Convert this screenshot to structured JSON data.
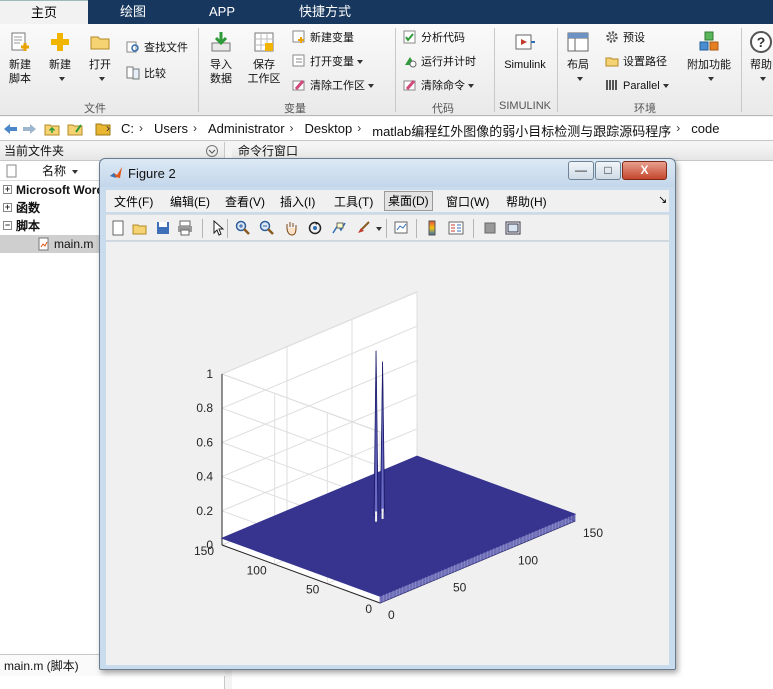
{
  "tabs": [
    {
      "label": "主页",
      "active": true
    },
    {
      "label": "绘图",
      "active": false
    },
    {
      "label": "APP",
      "active": false
    },
    {
      "label": "快捷方式",
      "active": false
    }
  ],
  "ribbon": {
    "file_group": {
      "label": "文件",
      "new_script": "新建\n脚本",
      "new": "新建",
      "open": "打开",
      "find_files": "查找文件",
      "compare": "比较"
    },
    "variable_group": {
      "label": "变量",
      "import_data": "导入\n数据",
      "save_workspace": "保存\n工作区",
      "new_variable": "新建变量",
      "open_variable": "打开变量",
      "clear_workspace": "清除工作区"
    },
    "code_group": {
      "label": "代码",
      "analyze_code": "分析代码",
      "run_and_time": "运行并计时",
      "clear_commands": "清除命令"
    },
    "simulink_group": {
      "label": "SIMULINK",
      "simulink": "Simulink"
    },
    "environment_group": {
      "label": "环境",
      "layout": "布局",
      "preferences": "预设",
      "set_path": "设置路径",
      "parallel": "Parallel",
      "addons": "附加功能"
    },
    "resources_group": {
      "help": "帮助"
    }
  },
  "path": {
    "crumbs": [
      "C:",
      "Users",
      "Administrator",
      "Desktop",
      "matlab编程红外图像的弱小目标检测与跟踪源码程序",
      "code"
    ]
  },
  "file_panel": {
    "title": "当前文件夹",
    "column_name": "名称",
    "tree": [
      {
        "label": "Microsoft Word ...",
        "expander": "+",
        "bold": true,
        "selected": false,
        "indent": 16
      },
      {
        "label": "函数",
        "expander": "+",
        "bold": true,
        "selected": false,
        "indent": 16
      },
      {
        "label": "脚本",
        "expander": "−",
        "bold": true,
        "selected": false,
        "indent": 16
      },
      {
        "label": "main.m",
        "expander": "",
        "bold": false,
        "selected": true,
        "indent": 54
      }
    ],
    "status": "main.m  (脚本)"
  },
  "command_window": {
    "title": "命令行窗口"
  },
  "figure": {
    "title": "Figure 2",
    "min_label": "—",
    "max_label": "□",
    "close_label": "X",
    "menus": [
      "文件(F)",
      "编辑(E)",
      "查看(V)",
      "插入(I)",
      "工具(T)",
      "桌面(D)",
      "窗口(W)",
      "帮助(H)"
    ],
    "active_menu_index": 5,
    "menu_dock_glyph": "↘",
    "toolbar_icons": [
      "new-figure-icon",
      "open-file-icon",
      "save-icon",
      "print-icon",
      "pointer-icon",
      "zoom-in-icon",
      "zoom-out-icon",
      "pan-icon",
      "rotate-3d-icon",
      "data-cursor-icon",
      "brush-icon",
      "link-plot-icon",
      "colorbar-icon",
      "legend-icon",
      "hide-plot-tools-icon",
      "show-plot-tools-icon"
    ]
  },
  "chart_data": {
    "type": "surface",
    "title": "",
    "xlabel": "",
    "ylabel": "",
    "zlabel": "",
    "x_ticks": [
      0,
      50,
      100,
      150
    ],
    "y_ticks": [
      0,
      50,
      100,
      150
    ],
    "z_ticks": [
      0,
      0.2,
      0.4,
      0.6,
      0.8,
      1
    ],
    "z_tick_labels": [
      "0",
      "0.2",
      "0.4",
      "0.6",
      "0.8",
      "1"
    ],
    "xlim": [
      0,
      150
    ],
    "ylim": [
      0,
      150
    ],
    "zlim": [
      0,
      1
    ],
    "grid": true,
    "surface_color": "#36348f",
    "baseline_z": 0.04,
    "peaks": [
      {
        "x": 78,
        "y": 100,
        "z": 1.0
      },
      {
        "x": 83,
        "y": 100,
        "z": 0.92
      }
    ]
  }
}
